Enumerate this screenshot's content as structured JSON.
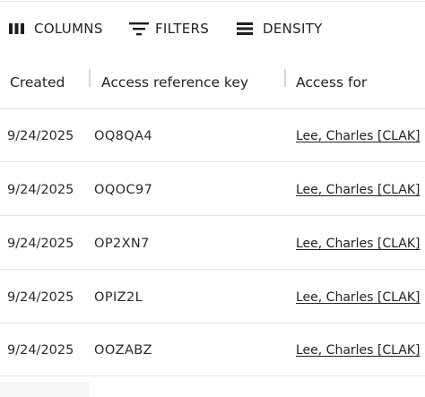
{
  "toolbar": {
    "columns_label": "COLUMNS",
    "filters_label": "FILTERS",
    "density_label": "DENSITY"
  },
  "table": {
    "columns": [
      "Created",
      "Access reference key",
      "Access for"
    ],
    "rows": [
      {
        "created": "9/24/2025",
        "key": "OQ8QA4",
        "access_for": "Lee, Charles [CLAK]"
      },
      {
        "created": "9/24/2025",
        "key": "OQOC97",
        "access_for": "Lee, Charles [CLAK]"
      },
      {
        "created": "9/24/2025",
        "key": "OP2XN7",
        "access_for": "Lee, Charles [CLAK]"
      },
      {
        "created": "9/24/2025",
        "key": "OPIZ2L",
        "access_for": "Lee, Charles [CLAK]"
      },
      {
        "created": "9/24/2025",
        "key": "OOZABZ",
        "access_for": "Lee, Charles [CLAK]"
      }
    ]
  },
  "icons": {
    "columns": "view-column-icon",
    "filters": "filter-list-icon",
    "density": "table-rows-icon"
  }
}
